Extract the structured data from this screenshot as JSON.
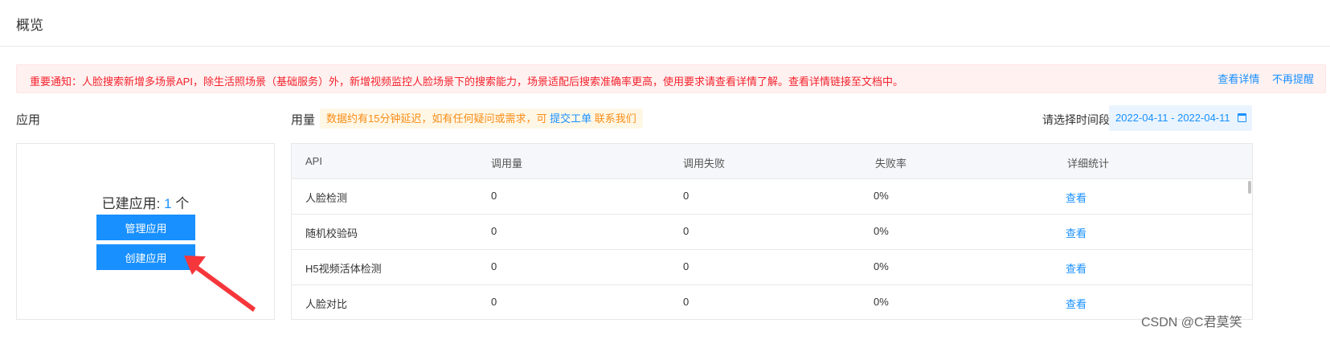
{
  "page": {
    "title": "概览"
  },
  "notice": {
    "text": "重要通知：人脸搜索新增多场景API，除生活照场景（基础服务）外，新增视频监控人脸场景下的搜索能力，场景适配后搜索准确率更高，使用要求请查看详情了解。查看详情链接至文档中。",
    "view_details": "查看详情",
    "dismiss": "不再提醒"
  },
  "apps": {
    "section_title": "应用",
    "count_label": "已建应用: ",
    "count": "1",
    "count_unit": " 个",
    "manage_button": "管理应用",
    "create_button": "创建应用"
  },
  "usage": {
    "section_title": "用量",
    "note_text": "数据约有15分钟延迟，如有任何疑问或需求，可 ",
    "submit_ticket": "提交工单",
    "contact_us": " 联系我们",
    "range_label": "请选择时间段",
    "date_range": "2022-04-11 - 2022-04-11",
    "calendar_icon": "calendar-icon"
  },
  "table": {
    "columns": [
      "API",
      "调用量",
      "调用失败",
      "失败率",
      "详细统计"
    ],
    "rows": [
      {
        "api": "人脸检测",
        "calls": "0",
        "failures": "0",
        "fail_rate": "0%",
        "action": "查看"
      },
      {
        "api": "随机校验码",
        "calls": "0",
        "failures": "0",
        "fail_rate": "0%",
        "action": "查看"
      },
      {
        "api": "H5视频活体检测",
        "calls": "0",
        "failures": "0",
        "fail_rate": "0%",
        "action": "查看"
      },
      {
        "api": "人脸对比",
        "calls": "0",
        "failures": "0",
        "fail_rate": "0%",
        "action": "查看"
      }
    ]
  },
  "annotation": {
    "arrow_color": "#f5363b"
  },
  "watermark": "CSDN @C君莫笑"
}
